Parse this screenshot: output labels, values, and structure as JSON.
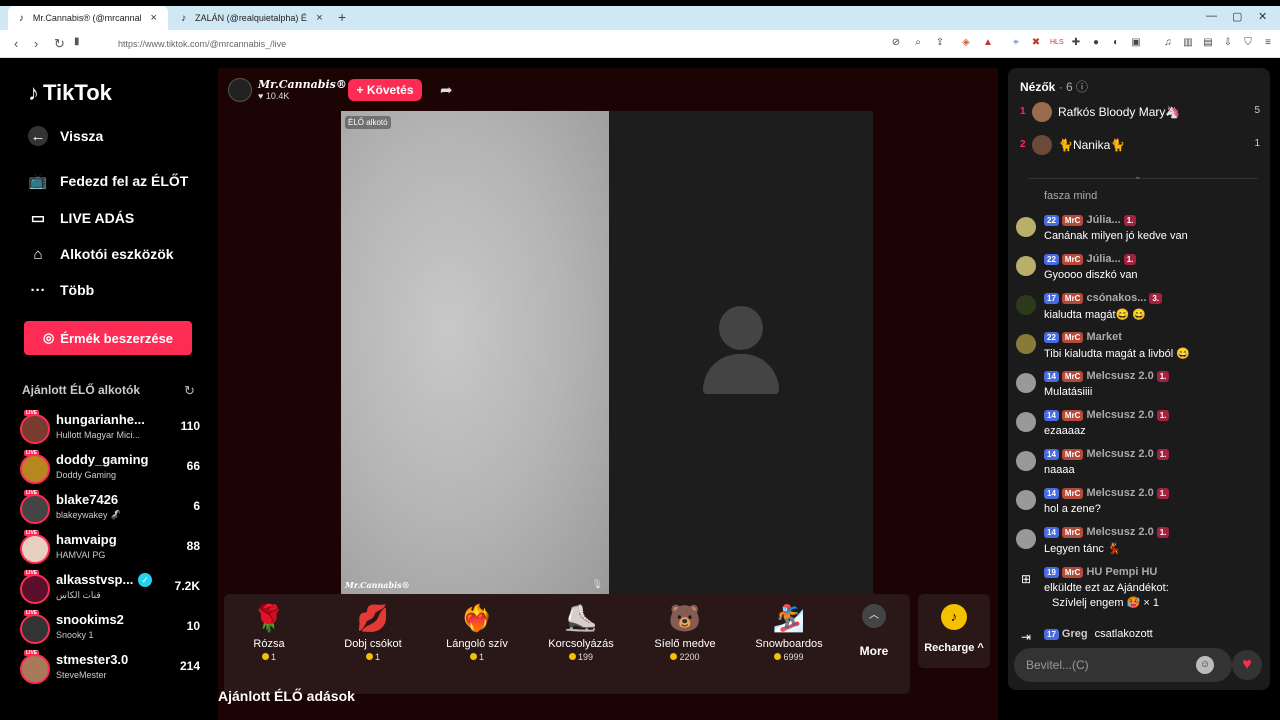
{
  "browser": {
    "tabs": [
      {
        "title": "Mr.Cannabis® (@mrcannabis",
        "active": true
      },
      {
        "title": "ZALÁN (@realquietalpha) ÉLŐ",
        "active": false
      }
    ],
    "new_tab": "+",
    "url": "https://www.tiktok.com/@mrcannabis_/live"
  },
  "sidebar": {
    "logo": "TikTok",
    "nav": [
      {
        "label": "Vissza",
        "icon": "back-arrow-icon"
      },
      {
        "label": "Fedezd fel az ÉLŐT",
        "icon": "tv-icon"
      },
      {
        "label": "LIVE ADÁS",
        "icon": "video-camera-icon"
      },
      {
        "label": "Alkotói eszközök",
        "icon": "home-tools-icon"
      },
      {
        "label": "Több",
        "icon": "ellipsis-icon"
      }
    ],
    "coins_button": "Érmék beszerzése",
    "recommended_heading": "Ajánlott ÉLŐ alkotók",
    "live_tag": "LIVE",
    "creators": [
      {
        "name": "hungarianhe...",
        "sub": "Hullott Magyar Mici...",
        "count": "110"
      },
      {
        "name": "doddy_gaming",
        "sub": "Doddy Gaming",
        "count": "66"
      },
      {
        "name": "blake7426",
        "sub": "blakeywakey 🦨",
        "count": "6"
      },
      {
        "name": "hamvaipg",
        "sub": "HAMVAI PG",
        "count": "88"
      },
      {
        "name": "alkasstvsp...",
        "sub": "قنات الكاس",
        "count": "7.2K"
      },
      {
        "name": "snookims2",
        "sub": "Snooky 1",
        "count": "10"
      },
      {
        "name": "stmester3.0",
        "sub": "SteveMester",
        "count": "214"
      }
    ]
  },
  "stream": {
    "host_name": "Mr.Cannabis®",
    "likes": "10.4K",
    "follow_label": "+ Követés",
    "cam_tag": "ÉLŐ alkotó",
    "cam_footer": "Mr.Cannabis®"
  },
  "gifts": [
    {
      "name": "Rózsa",
      "price": "1",
      "icon": "🌹"
    },
    {
      "name": "Dobj csókot",
      "price": "1",
      "icon": "💋"
    },
    {
      "name": "Lángoló szív",
      "price": "1",
      "icon": "❤️‍🔥"
    },
    {
      "name": "Korcsolyázás",
      "price": "199",
      "icon": "⛸️"
    },
    {
      "name": "Síelő medve",
      "price": "2200",
      "icon": "🐻"
    },
    {
      "name": "Snowboardos",
      "price": "6999",
      "icon": "🏂"
    }
  ],
  "more_label": "More",
  "recharge_label": "Recharge ^",
  "recommended_section": "Ajánlott ÉLŐ adások",
  "chat": {
    "viewers_label": "Nézők",
    "viewers_count": "· 6",
    "viewers": [
      {
        "rank": "1",
        "name": "Rafkós Bloody Mary🦄",
        "count": "5"
      },
      {
        "rank": "2",
        "name": "🐈Nanika🐈",
        "count": "1"
      }
    ],
    "messages": [
      {
        "user": "",
        "text": "fasza mind",
        "badges": []
      },
      {
        "user": "Júlia...",
        "text": "Canának milyen jó kedve van",
        "badges": [
          "22",
          "MrC",
          "1."
        ]
      },
      {
        "user": "Júlia...",
        "text": "Gyoooo diszkó van",
        "badges": [
          "22",
          "MrC",
          "1."
        ]
      },
      {
        "user": "csónakos...",
        "text": "kialudta magát😄 😄",
        "badges": [
          "17",
          "MrC",
          "3."
        ]
      },
      {
        "user": "Market",
        "text": "Tibi kialudta magát a livból 😄",
        "badges": [
          "22",
          "MrC"
        ]
      },
      {
        "user": "Melcsusz 2.0",
        "text": "Mulatásiiii",
        "badges": [
          "14",
          "MrC",
          "1."
        ]
      },
      {
        "user": "Melcsusz 2.0",
        "text": "ezaaaaz",
        "badges": [
          "14",
          "MrC",
          "1."
        ]
      },
      {
        "user": "Melcsusz 2.0",
        "text": "naaaa",
        "badges": [
          "14",
          "MrC",
          "1."
        ]
      },
      {
        "user": "Melcsusz 2.0",
        "text": "hol a zene?",
        "badges": [
          "14",
          "MrC",
          "1."
        ]
      },
      {
        "user": "Melcsusz 2.0",
        "text": "Legyen tánc 💃",
        "badges": [
          "14",
          "MrC",
          "1."
        ]
      },
      {
        "user": "HU Pempi HU",
        "text": "elküldte ezt az Ajándékot:",
        "badges": [
          "19",
          "MrC"
        ],
        "extra": "Szívlelj engem 🥵 × 1"
      },
      {
        "user": "Greg",
        "text": "csatlakozott",
        "badges": [
          "17"
        ]
      }
    ],
    "input_placeholder": "Bevitel...(C)"
  }
}
